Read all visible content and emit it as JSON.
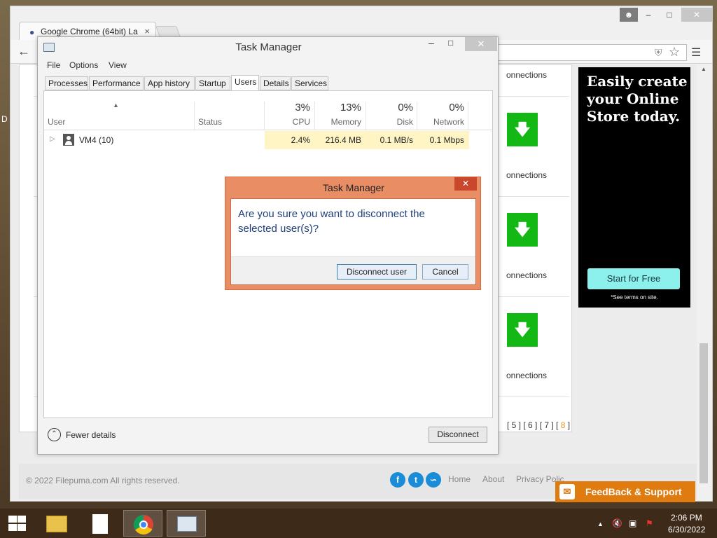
{
  "desktop": {
    "edge_letter": "D"
  },
  "browser": {
    "tab_title": "Google Chrome (64bit) La",
    "page": {
      "connections_label": "onnections",
      "pagination_prefix": "[ 5 ] [ 6 ] [ 7 ] [ ",
      "pagination_current": "8",
      "pagination_suffix": " ]",
      "ad": {
        "headline": "Easily create your Online Store today.",
        "button": "Start for Free",
        "terms": "*See terms on site."
      },
      "footer": {
        "copyright": "© 2022 Filepuma.com All rights reserved.",
        "links": [
          "Home",
          "About",
          "Privacy Polic"
        ],
        "feedback": "FeedBack & Support"
      }
    }
  },
  "task_manager": {
    "title": "Task Manager",
    "menu": [
      "File",
      "Options",
      "View"
    ],
    "tabs": [
      "Processes",
      "Performance",
      "App history",
      "Startup",
      "Users",
      "Details",
      "Services"
    ],
    "active_tab": "Users",
    "columns": {
      "user": "User",
      "status": "Status",
      "cpu": {
        "pct": "3%",
        "name": "CPU"
      },
      "memory": {
        "pct": "13%",
        "name": "Memory"
      },
      "disk": {
        "pct": "0%",
        "name": "Disk"
      },
      "network": {
        "pct": "0%",
        "name": "Network"
      }
    },
    "rows": [
      {
        "user": "VM4 (10)",
        "cpu": "2.4%",
        "memory": "216.4 MB",
        "disk": "0.1 MB/s",
        "network": "0.1 Mbps"
      }
    ],
    "fewer_details": "Fewer details",
    "disconnect_button": "Disconnect"
  },
  "dialog": {
    "title": "Task Manager",
    "message": "Are you sure you want to disconnect the selected user(s)?",
    "confirm": "Disconnect user",
    "cancel": "Cancel"
  },
  "taskbar": {
    "time": "2:06 PM",
    "date": "6/30/2022"
  }
}
